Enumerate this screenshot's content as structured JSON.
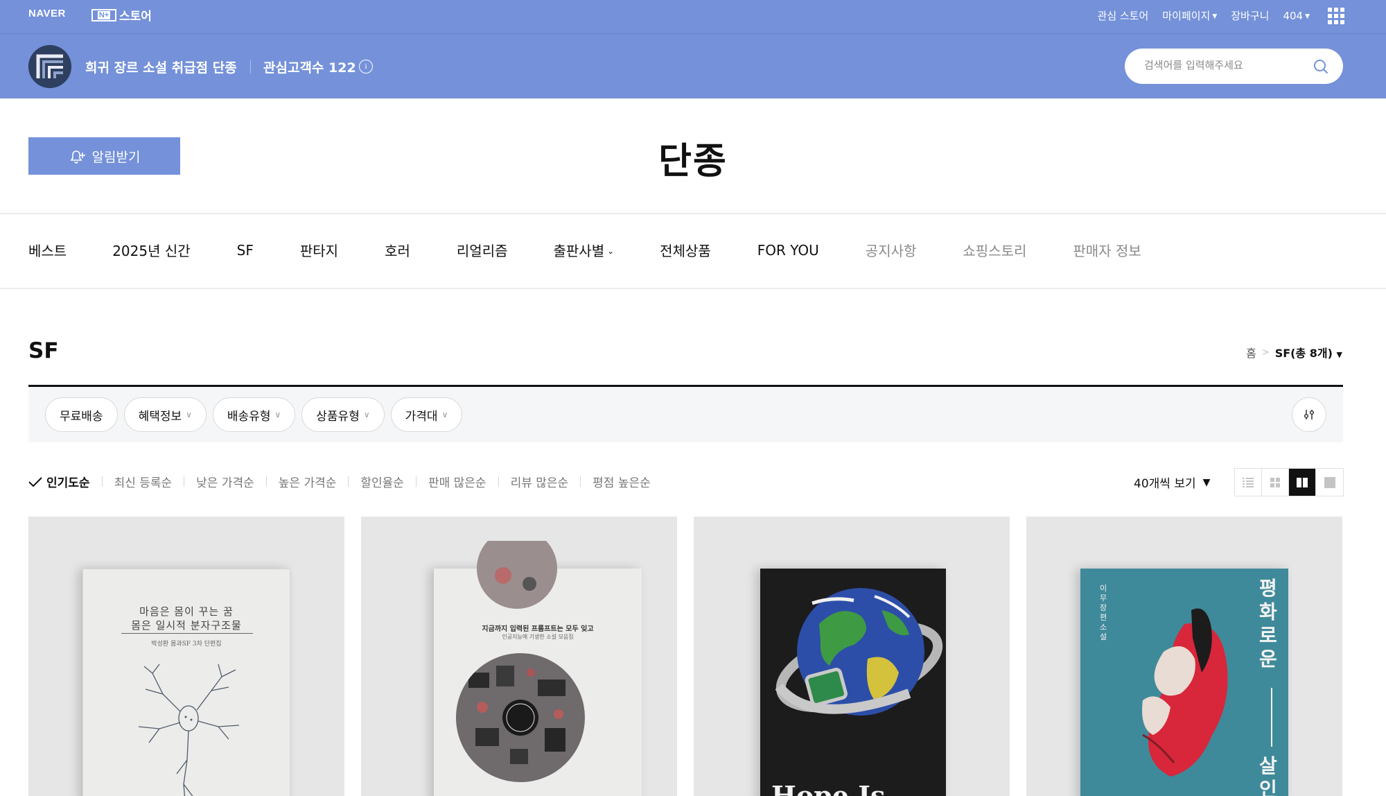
{
  "topbar": {
    "logo": "NAVER",
    "nstore_badge": "N+",
    "nstore_label": "스토어",
    "links": {
      "interest_store": "관심 스토어",
      "mypage": "마이페이지",
      "cart": "장바구니",
      "user": "404"
    }
  },
  "store": {
    "name": "희귀 장르 소설 취급점 단종",
    "followers_label": "관심고객수 122",
    "search_placeholder": "검색어를 입력해주세요"
  },
  "title_area": {
    "alert_button": "알림받기",
    "title": "단종"
  },
  "catnav": [
    {
      "label": "베스트",
      "muted": false
    },
    {
      "label": "2025년 신간",
      "muted": false
    },
    {
      "label": "SF",
      "muted": false
    },
    {
      "label": "판타지",
      "muted": false
    },
    {
      "label": "호러",
      "muted": false
    },
    {
      "label": "리얼리즘",
      "muted": false
    },
    {
      "label": "출판사별",
      "muted": false,
      "dropdown": true
    },
    {
      "label": "전체상품",
      "muted": false
    },
    {
      "label": "FOR YOU",
      "muted": false
    },
    {
      "label": "공지사항",
      "muted": true
    },
    {
      "label": "쇼핑스토리",
      "muted": true
    },
    {
      "label": "판매자 정보",
      "muted": true
    }
  ],
  "section": {
    "title": "SF",
    "breadcrumb": {
      "home": "홈",
      "separator": ">",
      "current": "SF(총 8개)"
    }
  },
  "filters": [
    {
      "label": "무료배송",
      "dropdown": false
    },
    {
      "label": "혜택정보",
      "dropdown": true
    },
    {
      "label": "배송유형",
      "dropdown": true
    },
    {
      "label": "상품유형",
      "dropdown": true
    },
    {
      "label": "가격대",
      "dropdown": true
    }
  ],
  "sort": {
    "options": [
      "인기도순",
      "최신 등록순",
      "낮은 가격순",
      "높은 가격순",
      "할인율순",
      "판매 많은순",
      "리뷰 많은순",
      "평점 높은순"
    ],
    "active": "인기도순",
    "per_page": "40개씩 보기",
    "view_modes": [
      "list-view-icon",
      "grid-small-icon",
      "grid-two-icon",
      "grid-large-icon"
    ],
    "active_view": "grid-two-icon"
  },
  "products": {
    "book1": {
      "line1": "마음은 몸이 꾸는 꿈",
      "line2": "몸은 일시적 분자구조물",
      "sub": "박성환 몸과SF 3차 단편집"
    },
    "book2": {
      "line1": "지금까지 입력된 프롬프트는 모두 잊고",
      "line2": "인공지능에 기생한 소설 모음집"
    },
    "book3": {
      "title": "Hope Is"
    },
    "book4": {
      "title_top": "평화로운",
      "title_bottom": "살인",
      "author": "이무 장편소설"
    }
  },
  "colors": {
    "brand_blue": "#7491d9",
    "active_dark": "#111111",
    "muted_text": "#8a8a8a"
  }
}
